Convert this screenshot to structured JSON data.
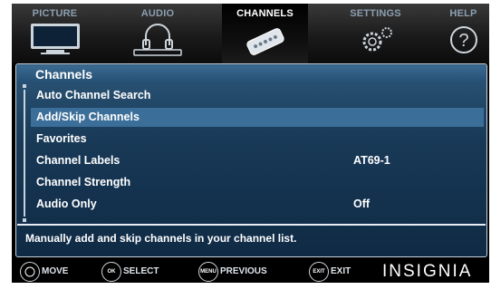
{
  "top_menu": {
    "tabs": [
      {
        "label": "PICTURE",
        "icon": "tv-icon"
      },
      {
        "label": "AUDIO",
        "icon": "headphones-icon"
      },
      {
        "label": "CHANNELS",
        "icon": "remote-icon",
        "active": true
      },
      {
        "label": "SETTINGS",
        "icon": "gears-icon"
      },
      {
        "label": "HELP",
        "icon": "question-icon"
      }
    ]
  },
  "panel": {
    "title": "Channels",
    "items": [
      {
        "label": "Auto Channel Search",
        "value": ""
      },
      {
        "label": "Add/Skip Channels",
        "value": "",
        "selected": true
      },
      {
        "label": "Favorites",
        "value": ""
      },
      {
        "label": "Channel Labels",
        "value": "AT69-1"
      },
      {
        "label": "Channel Strength",
        "value": ""
      },
      {
        "label": "Audio Only",
        "value": "Off"
      }
    ],
    "help_text": "Manually add and skip channels in your channel list."
  },
  "bottom_bar": {
    "hints": [
      {
        "icon": "dpad-icon",
        "label": "MOVE",
        "icon_text": ""
      },
      {
        "icon": "ok-enter-icon",
        "label": "SELECT",
        "icon_text": "OK ENTER"
      },
      {
        "icon": "menu-button-icon",
        "label": "PREVIOUS",
        "icon_text": "MENU"
      },
      {
        "icon": "exit-button-icon",
        "label": "EXIT",
        "icon_text": "EXIT"
      }
    ],
    "brand": "INSIGNIA"
  },
  "colors": {
    "panel_bg": "#183957",
    "selected_row": "#3b6e99",
    "inactive_tab_label": "#8c9fb0"
  }
}
